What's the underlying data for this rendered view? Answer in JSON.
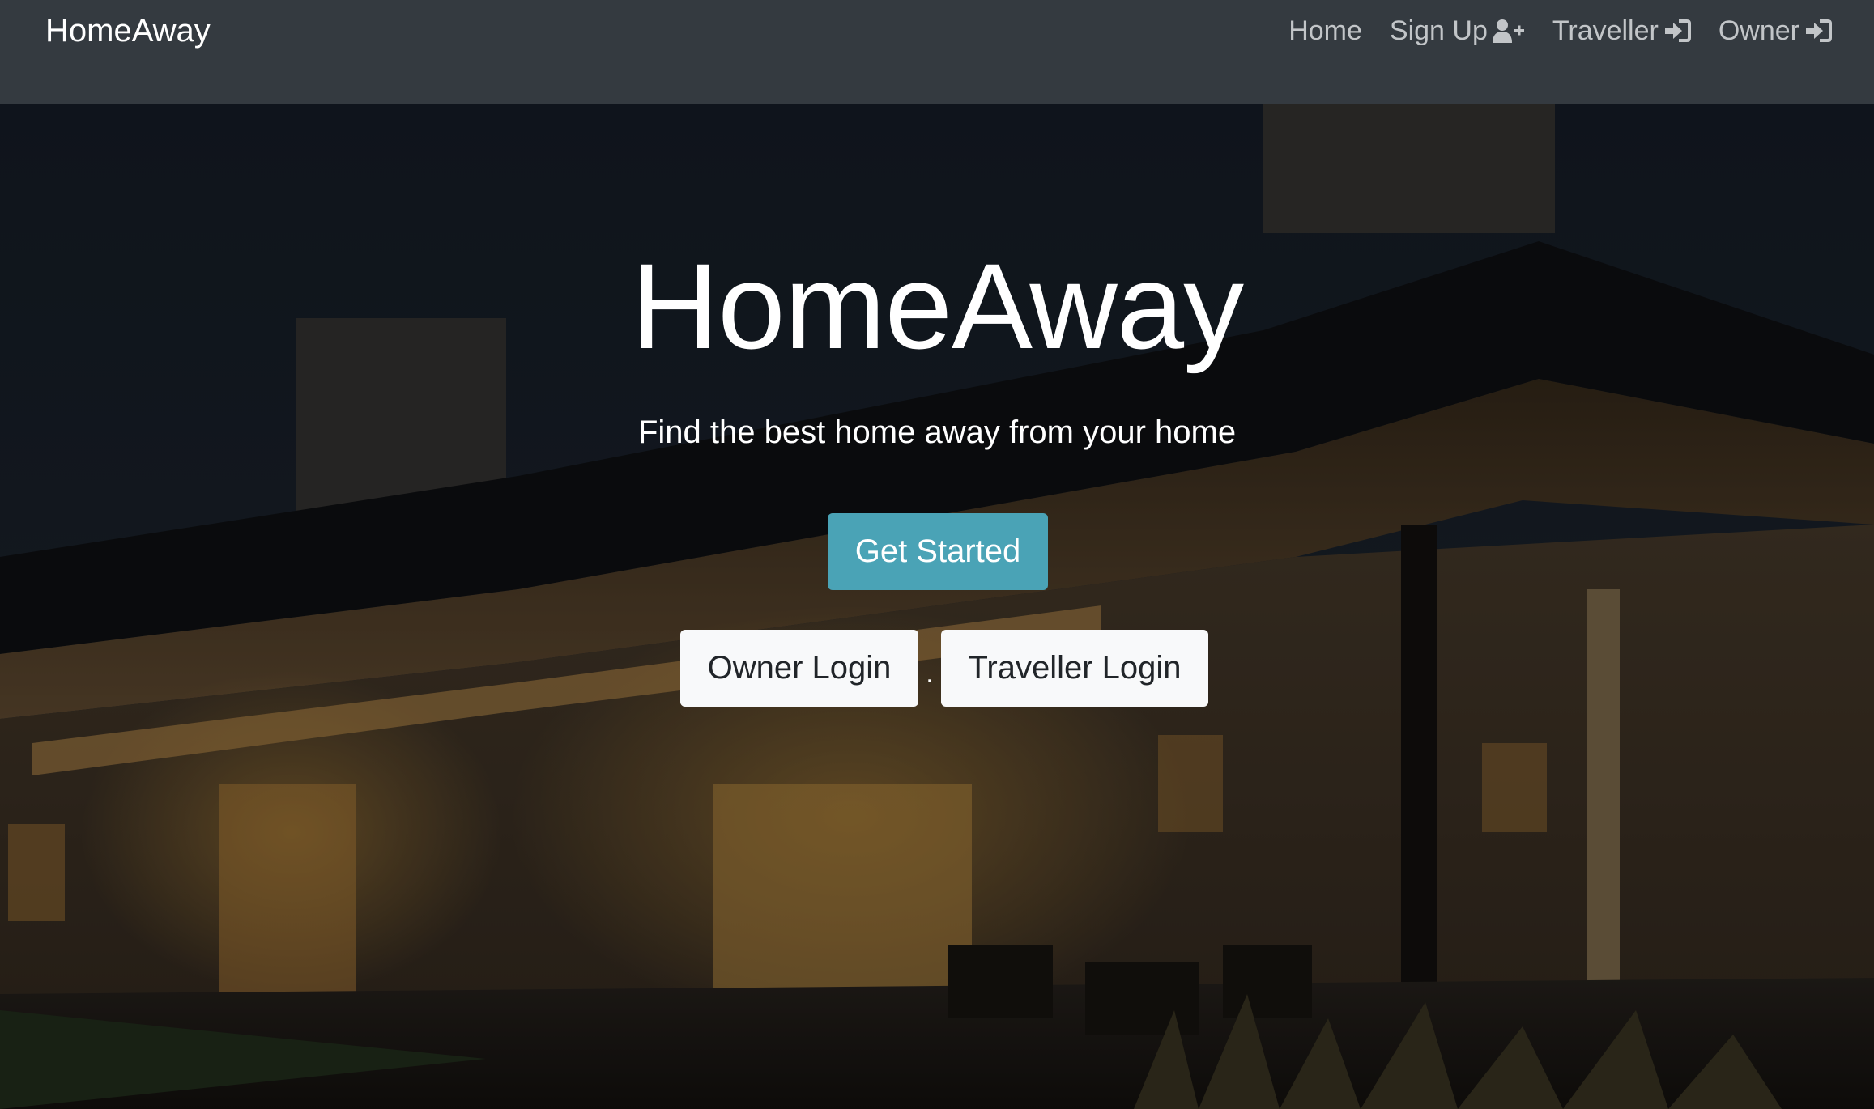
{
  "navbar": {
    "brand": "HomeAway",
    "links": [
      {
        "label": "Home",
        "icon": null
      },
      {
        "label": "Sign Up",
        "icon": "user-plus-icon"
      },
      {
        "label": "Traveller",
        "icon": "sign-in-icon"
      },
      {
        "label": "Owner",
        "icon": "sign-in-icon"
      }
    ]
  },
  "hero": {
    "background": "night photo of a modern house with lit windows and a patio",
    "title": "HomeAway",
    "subtitle": "Find the best home away from your home",
    "get_started_label": "Get Started",
    "owner_login_label": "Owner Login",
    "separator": ".",
    "traveller_login_label": "Traveller Login"
  },
  "colors": {
    "navbar_bg": "#343a40",
    "nav_link": "#c2c5c8",
    "primary_button": "#4aa3b6",
    "light_button": "#f8f9fa"
  }
}
